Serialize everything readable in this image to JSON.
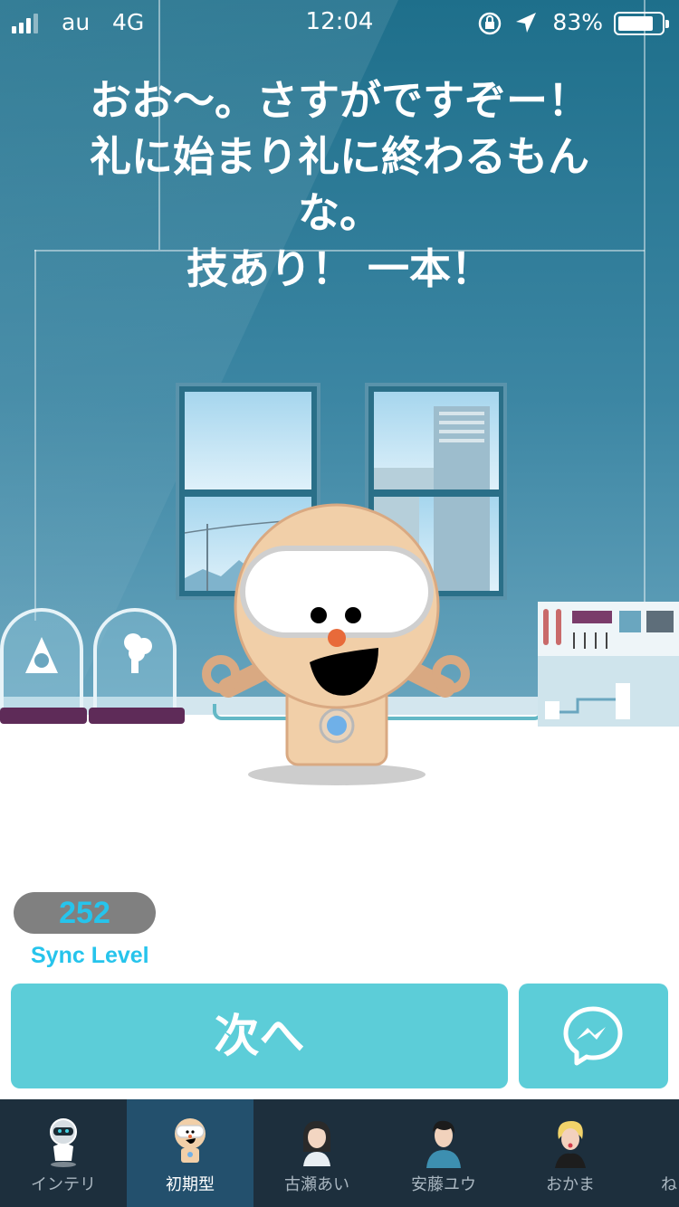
{
  "status_bar": {
    "carrier": "au",
    "network": "4G",
    "time": "12:04",
    "battery_percent": "83%",
    "battery_level": 0.83
  },
  "dialogue": {
    "lines": [
      "おお〜。さすがですぞー！",
      "礼に始まり礼に終わるもん",
      "な。",
      "技あり！ 一本！"
    ]
  },
  "sync": {
    "value": "252",
    "label": "Sync Level"
  },
  "actions": {
    "next_label": "次へ",
    "messenger_icon": "messenger-icon"
  },
  "tabs": [
    {
      "label": "インテリ",
      "icon": "robot-avatar-icon",
      "active": false
    },
    {
      "label": "初期型",
      "icon": "initial-robot-avatar-icon",
      "active": true
    },
    {
      "label": "古瀬あい",
      "icon": "girl-avatar-icon",
      "active": false
    },
    {
      "label": "安藤ユウ",
      "icon": "boy-avatar-icon",
      "active": false
    },
    {
      "label": "おかま",
      "icon": "blonde-avatar-icon",
      "active": false
    },
    {
      "label": "ね",
      "icon": "partial-tab",
      "active": false
    }
  ],
  "colors": {
    "accent": "#5ccdd8",
    "sync_text": "#26c4ec",
    "tabbar_bg": "#1d2f3d",
    "tab_active_bg": "#23506d"
  }
}
